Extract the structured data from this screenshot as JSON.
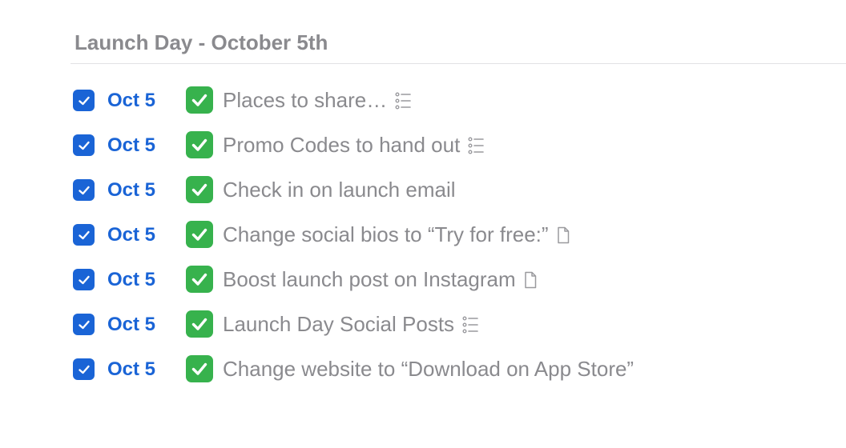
{
  "section": {
    "title": "Launch Day - October 5th"
  },
  "colors": {
    "accent": "#1a64d6",
    "muted_text": "#8a8a8e",
    "emoji_green": "#37b24d",
    "divider": "#e2e2e4"
  },
  "tasks": [
    {
      "completed": true,
      "date": "Oct 5",
      "emoji": "white-check-mark-emoji",
      "title": "Places to share…",
      "trailing_icon": "checklist-icon"
    },
    {
      "completed": true,
      "date": "Oct 5",
      "emoji": "white-check-mark-emoji",
      "title": "Promo Codes to hand out",
      "trailing_icon": "checklist-icon"
    },
    {
      "completed": true,
      "date": "Oct 5",
      "emoji": "white-check-mark-emoji",
      "title": "Check in on launch email",
      "trailing_icon": ""
    },
    {
      "completed": true,
      "date": "Oct 5",
      "emoji": "white-check-mark-emoji",
      "title": "Change social bios to “Try for free:”",
      "trailing_icon": "note-icon"
    },
    {
      "completed": true,
      "date": "Oct 5",
      "emoji": "white-check-mark-emoji",
      "title": "Boost launch post on Instagram",
      "trailing_icon": "note-icon"
    },
    {
      "completed": true,
      "date": "Oct 5",
      "emoji": "white-check-mark-emoji",
      "title": "Launch Day Social Posts",
      "trailing_icon": "checklist-icon"
    },
    {
      "completed": true,
      "date": "Oct 5",
      "emoji": "white-check-mark-emoji",
      "title": "Change website to “Download on App Store”",
      "trailing_icon": ""
    }
  ]
}
